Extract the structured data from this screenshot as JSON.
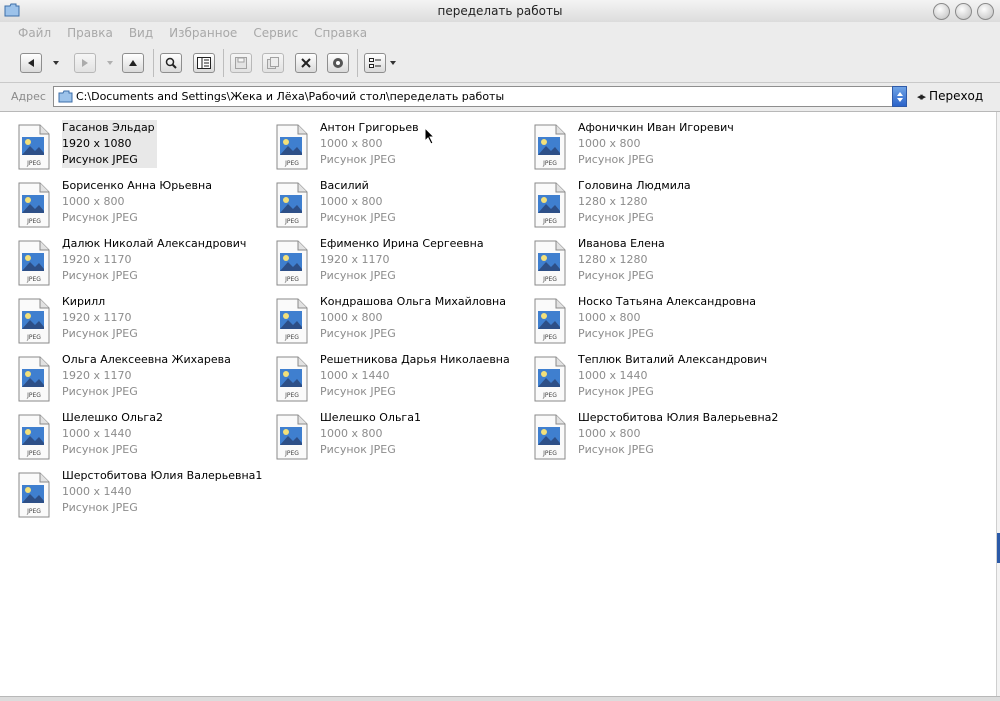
{
  "window": {
    "title": "переделать работы"
  },
  "menu": [
    "Файл",
    "Правка",
    "Вид",
    "Избранное",
    "Сервис",
    "Справка"
  ],
  "toolbar": {
    "buttons": [
      "back",
      "forward",
      "up",
      "search",
      "folders",
      "save",
      "copy-to",
      "delete",
      "properties",
      "views"
    ]
  },
  "address": {
    "label": "Адрес",
    "value": "C:\\Documents and Settings\\Жека и Лёха\\Рабочий стол\\переделать работы",
    "go_label": "Переход"
  },
  "files": [
    {
      "name": "Гасанов Эльдар",
      "dims": "1920 x 1080",
      "type": "Рисунок JPEG",
      "selected": true
    },
    {
      "name": "Антон Григорьев",
      "dims": "1000 x 800",
      "type": "Рисунок JPEG"
    },
    {
      "name": "Афоничкин Иван Игоревич",
      "dims": "1000 x 800",
      "type": "Рисунок JPEG"
    },
    {
      "name": "Борисенко Анна Юрьевна",
      "dims": "1000 x 800",
      "type": "Рисунок JPEG"
    },
    {
      "name": "Василий",
      "dims": "1000 x 800",
      "type": "Рисунок JPEG"
    },
    {
      "name": "Головина Людмила",
      "dims": "1280 x 1280",
      "type": "Рисунок JPEG"
    },
    {
      "name": "Далюк Николай Александрович",
      "dims": "1920 x 1170",
      "type": "Рисунок JPEG"
    },
    {
      "name": "Ефименко Ирина Сергеевна",
      "dims": "1920 x 1170",
      "type": "Рисунок JPEG"
    },
    {
      "name": "Иванова Елена",
      "dims": "1280 x 1280",
      "type": "Рисунок JPEG"
    },
    {
      "name": "Кирилл",
      "dims": "1920 x 1170",
      "type": "Рисунок JPEG"
    },
    {
      "name": "Кондрашова Ольга Михайловна",
      "dims": "1000 x 800",
      "type": "Рисунок JPEG"
    },
    {
      "name": "Носко Татьяна Александровна",
      "dims": "1000 x 800",
      "type": "Рисунок JPEG"
    },
    {
      "name": "Ольга Алексеевна Жихарева",
      "dims": "1920 x 1170",
      "type": "Рисунок JPEG"
    },
    {
      "name": "Решетникова Дарья Николаевна",
      "dims": "1000 x 1440",
      "type": "Рисунок JPEG"
    },
    {
      "name": "Теплюк Виталий Александрович",
      "dims": "1000 x 1440",
      "type": "Рисунок JPEG"
    },
    {
      "name": "Шелешко Ольга2",
      "dims": "1000 x 1440",
      "type": "Рисунок JPEG"
    },
    {
      "name": "Шелешко Ольга1",
      "dims": "1000 x 800",
      "type": "Рисунок JPEG"
    },
    {
      "name": "Шерстобитова Юлия Валерьевна2",
      "dims": "1000 x 800",
      "type": "Рисунок JPEG"
    },
    {
      "name": "Шерстобитова Юлия Валерьевна1",
      "dims": "1000 x 1440",
      "type": "Рисунок JPEG"
    }
  ],
  "icon_label": "JPEG",
  "colors": {
    "selection": "#e8e8e8",
    "secondary_text": "#8c8c8c",
    "menu_disabled": "#a8a8a8",
    "accent": "#2b63c9"
  }
}
